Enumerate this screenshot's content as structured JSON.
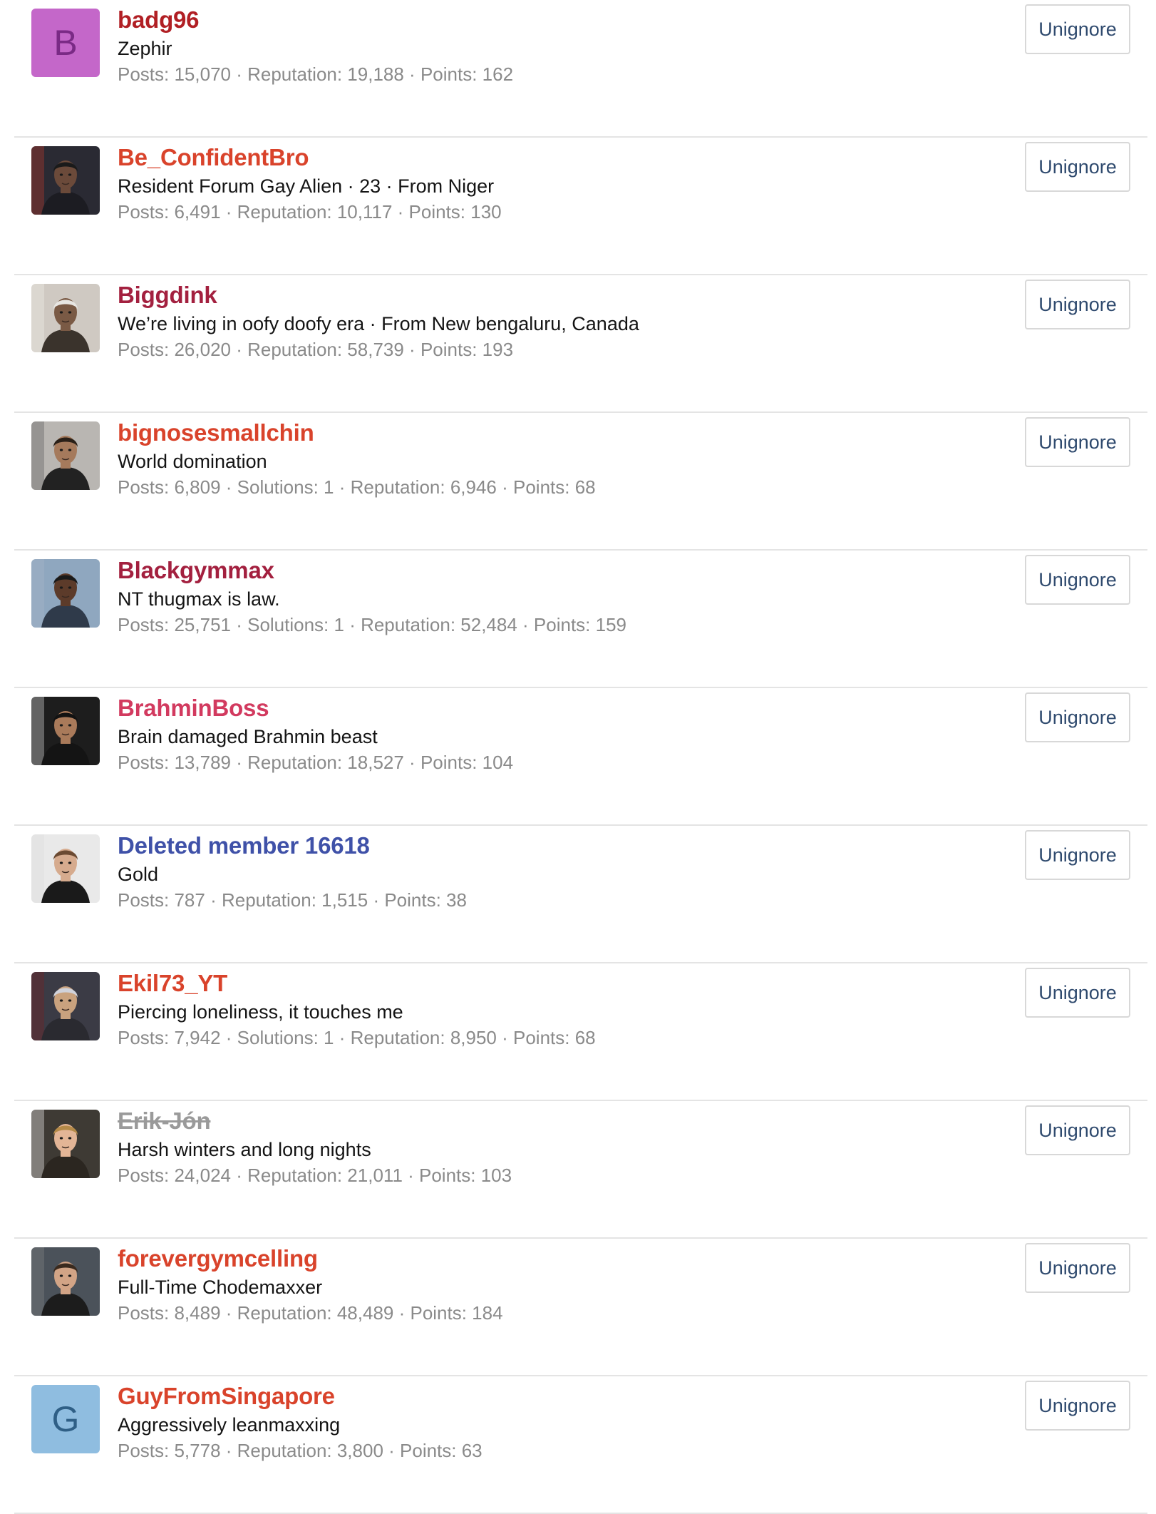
{
  "actions": {
    "unignore_label": "Unignore"
  },
  "members": [
    {
      "username": "badg96",
      "username_color": "#b11f24",
      "title": "Zephir",
      "stats": "Posts: 15,070 · Reputation: 19,188 · Points: 162",
      "avatar": {
        "type": "letter",
        "letter": "B",
        "bg": "#c467c9",
        "fg": "#7a2a85"
      }
    },
    {
      "username": "Be_ConfidentBro",
      "username_color": "#d9432b",
      "title": "Resident Forum Gay Alien · 23 · From Niger",
      "stats": "Posts: 6,491 · Reputation: 10,117 · Points: 130",
      "avatar": {
        "type": "photo",
        "icon": "man-at-desk-photo"
      }
    },
    {
      "username": "Biggdink",
      "username_color": "#a3203f",
      "title": "We’re living in oofy doofy era · From New bengaluru, Canada",
      "stats": "Posts: 26,020 · Reputation: 58,739 · Points: 193",
      "avatar": {
        "type": "photo",
        "icon": "hooded-figure-photo"
      }
    },
    {
      "username": "bignosesmallchin",
      "username_color": "#d9432b",
      "title": "World domination",
      "stats": "Posts: 6,809 · Solutions: 1 · Reputation: 6,946 · Points: 68",
      "avatar": {
        "type": "photo",
        "icon": "man-portrait-photo"
      }
    },
    {
      "username": "Blackgymmax",
      "username_color": "#a3203f",
      "title": "NT thugmax is law.",
      "stats": "Posts: 25,751 · Solutions: 1 · Reputation: 52,484 · Points: 159",
      "avatar": {
        "type": "photo",
        "icon": "man-cap-photo"
      }
    },
    {
      "username": "BrahminBoss",
      "username_color": "#d23a5f",
      "title": "Brain damaged Brahmin beast",
      "stats": "Posts: 13,789 · Reputation: 18,527 · Points: 104",
      "avatar": {
        "type": "photo",
        "icon": "man-portrait-photo"
      }
    },
    {
      "username": "Deleted member 16618",
      "username_color": "#3f51a8",
      "title": "Gold",
      "stats": "Posts: 787 · Reputation: 1,515 · Points: 38",
      "avatar": {
        "type": "photo",
        "icon": "man-portrait-photo"
      }
    },
    {
      "username": "Ekil73_YT",
      "username_color": "#d9432b",
      "title": "Piercing loneliness, it touches me",
      "stats": "Posts: 7,942 · Solutions: 1 · Reputation: 8,950 · Points: 68",
      "avatar": {
        "type": "photo",
        "icon": "anime-character-photo"
      }
    },
    {
      "username": "Erik-Jón",
      "username_color": "#9a9a9a",
      "username_strike": true,
      "title": "Harsh winters and long nights",
      "stats": "Posts: 24,024 · Reputation: 21,011 · Points: 103",
      "avatar": {
        "type": "photo",
        "icon": "woman-smiling-photo"
      }
    },
    {
      "username": "forevergymcelling",
      "username_color": "#d9432b",
      "title": "Full-Time Chodemaxxer",
      "stats": "Posts: 8,489 · Reputation: 48,489 · Points: 184",
      "avatar": {
        "type": "photo",
        "icon": "man-portrait-photo"
      }
    },
    {
      "username": "GuyFromSingapore",
      "username_color": "#d9432b",
      "title": "Aggressively leanmaxxing",
      "stats": "Posts: 5,778 · Reputation: 3,800 · Points: 63",
      "avatar": {
        "type": "letter",
        "letter": "G",
        "bg": "#8fbde0",
        "fg": "#2f5f86"
      }
    }
  ]
}
